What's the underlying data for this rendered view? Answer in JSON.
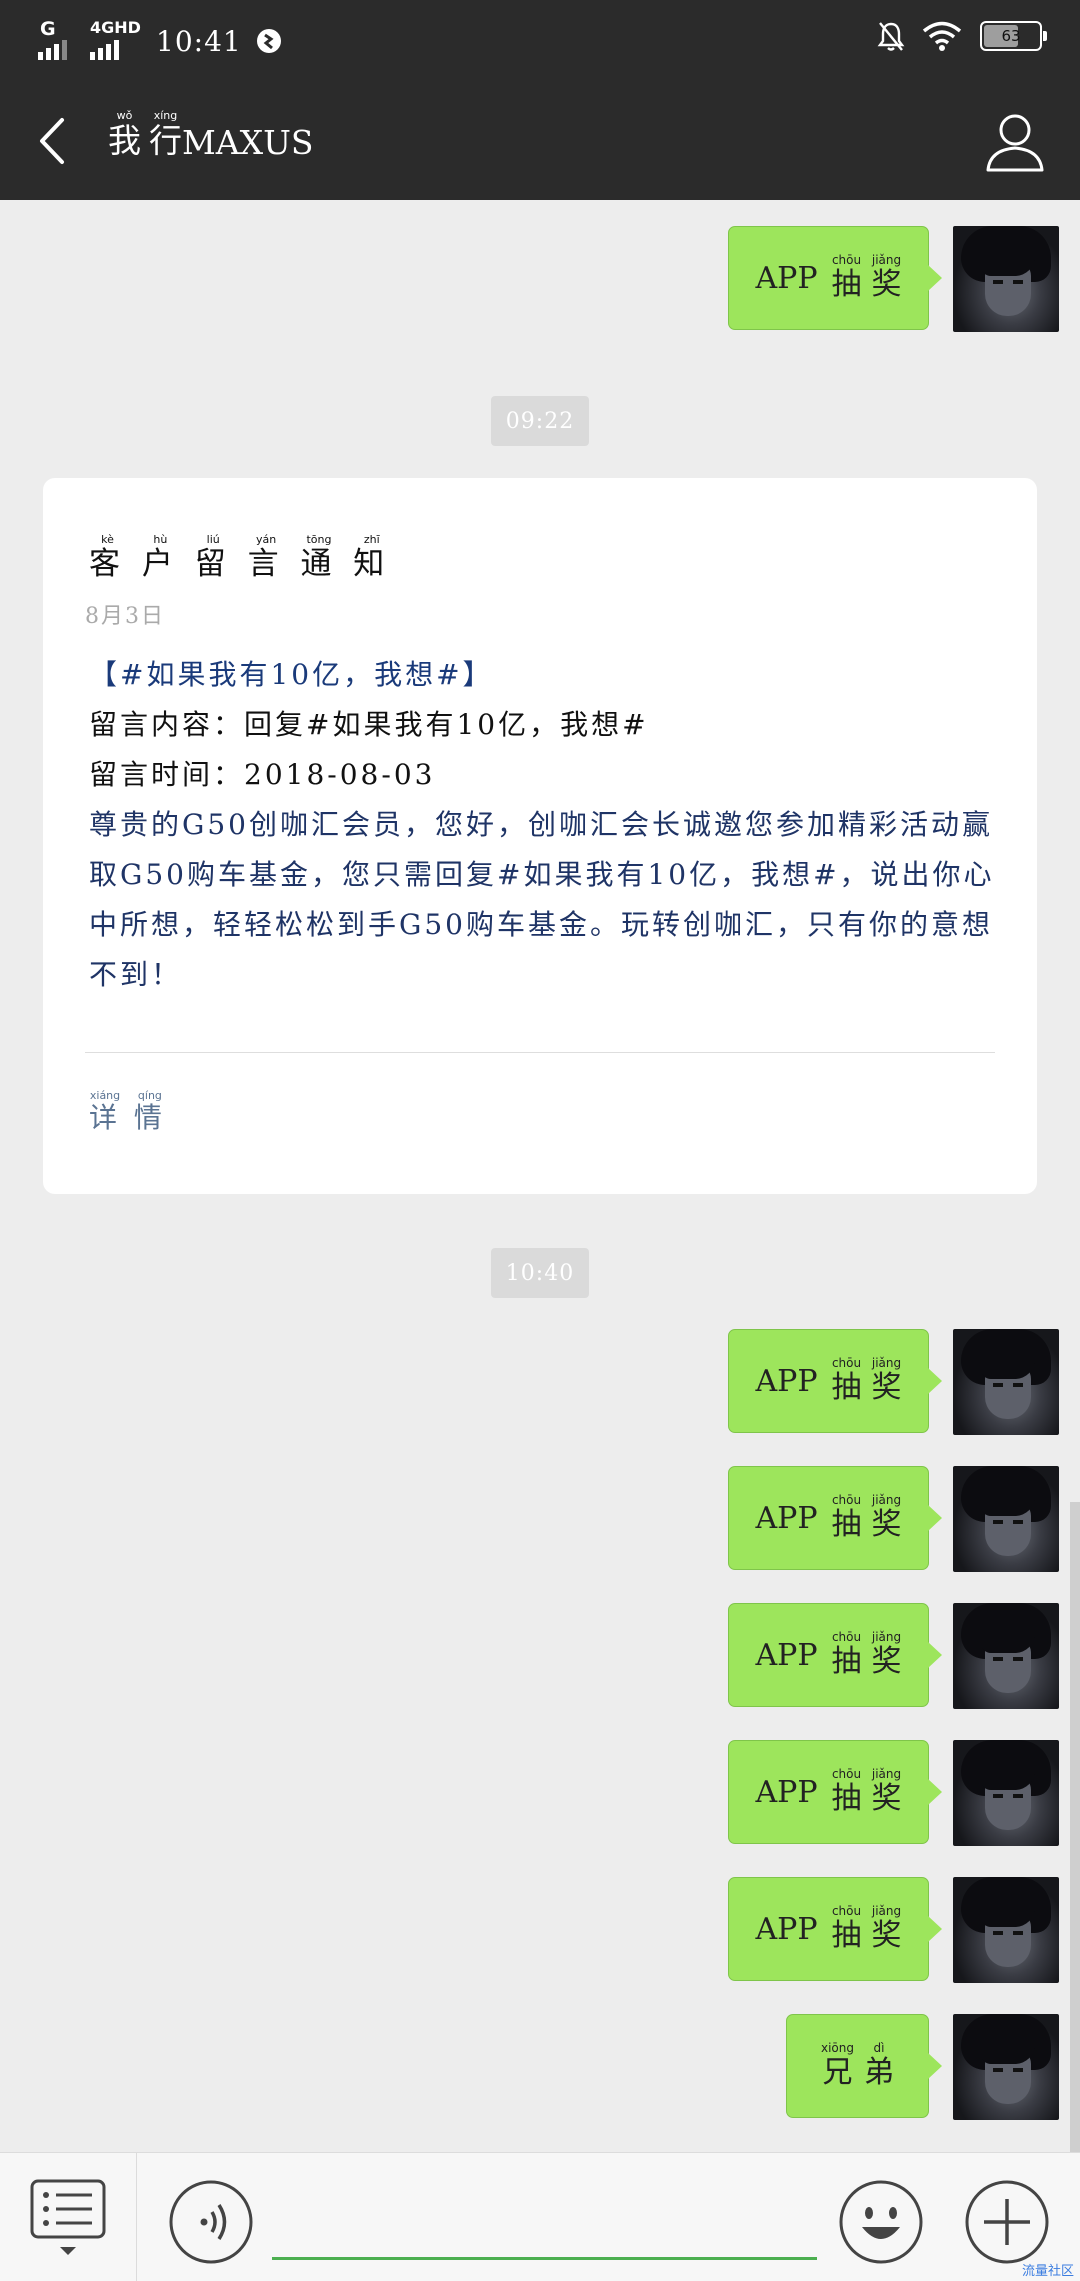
{
  "status_bar": {
    "network_label_1": "G",
    "network_label_2": "4GHD",
    "time": "10:41",
    "battery": "63",
    "battery_level_percent": 63,
    "icons": [
      "signal-icon",
      "alarm-off-icon",
      "wifi-icon",
      "battery-icon"
    ]
  },
  "header": {
    "title_ruby": [
      {
        "char": "我",
        "pinyin": "wǒ"
      },
      {
        "char": "行",
        "pinyin": "xíng"
      }
    ],
    "title_suffix": "MAXUS"
  },
  "messages": {
    "app_char1": {
      "char": "抽",
      "pinyin": "chōu"
    },
    "app_char2": {
      "char": "奖",
      "pinyin": "jiǎng"
    },
    "app_prefix": "APP",
    "brother": [
      {
        "char": "兄",
        "pinyin": "xiōng"
      },
      {
        "char": "弟",
        "pinyin": "dì"
      }
    ]
  },
  "timestamps": {
    "first": "09:22",
    "second": "10:40"
  },
  "card": {
    "title": [
      {
        "char": "客",
        "pinyin": "kè"
      },
      {
        "char": "户",
        "pinyin": "hù"
      },
      {
        "char": "留",
        "pinyin": "liú"
      },
      {
        "char": "言",
        "pinyin": "yán"
      },
      {
        "char": "通",
        "pinyin": "tōng"
      },
      {
        "char": "知",
        "pinyin": "zhī"
      }
    ],
    "date": "8月3日",
    "tag_line": "【#如果我有10亿，我想#】",
    "content_label": "留言内容：",
    "content_value": "回复#如果我有10亿，我想#",
    "time_label": "留言时间：",
    "time_value": "2018-08-03",
    "body": "尊贵的G50创咖汇会员，您好，创咖汇会长诚邀您参加精彩活动赢取G50购车基金，您只需回复#如果我有10亿，我想#，说出你心中所想，轻轻松松到手G50购车基金。玩转创咖汇，只有你的意想不到！",
    "details_link": [
      {
        "char": "详",
        "pinyin": "xiáng"
      },
      {
        "char": "情",
        "pinyin": "qíng"
      }
    ]
  },
  "input_bar": {
    "icons": [
      "menu-list-icon",
      "voice-icon",
      "emoji-icon",
      "plus-icon"
    ]
  },
  "watermark": "流量社区"
}
